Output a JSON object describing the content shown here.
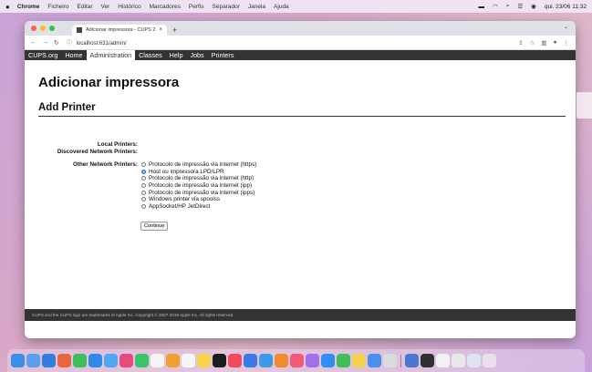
{
  "menubar": {
    "apple": "",
    "app": "Chrome",
    "items": [
      "Ficheiro",
      "Editar",
      "Ver",
      "Histórico",
      "Marcadores",
      "Perfis",
      "Separador",
      "Janela",
      "Ajuda"
    ],
    "clock": "qui. 23/06  11:32"
  },
  "browser": {
    "tab_title": "Adicionar impressora - CUPS 2.",
    "tab_close": "×",
    "new_tab": "+",
    "url_icon": "ⓘ",
    "url": "localhost:631/admin/"
  },
  "cupsnav": {
    "items": [
      "CUPS.org",
      "Home",
      "Administration",
      "Classes",
      "Help",
      "Jobs",
      "Printers"
    ],
    "active_index": 2
  },
  "page": {
    "heading": "Adicionar impressora",
    "subheading": "Add Printer",
    "labels": {
      "local": "Local Printers:",
      "discovered": "Discovered Network Printers:",
      "other": "Other Network Printers:"
    },
    "options": [
      "Protocolo de impressão via internet (https)",
      "Host ou impressora LPD/LPR",
      "Protocolo de impressão via internet (http)",
      "Protocolo de impressão via internet (ipp)",
      "Protocolo de impressão via internet (ipps)",
      "Windows printer via spoolss",
      "AppSocket/HP JetDirect"
    ],
    "selected_index": 1,
    "button": "Continue"
  },
  "footer": {
    "text": "CUPS and the CUPS logo are trademarks of Apple Inc. Copyright © 2007-2019 Apple Inc. All rights reserved."
  },
  "colors": {
    "cups_nav_bg": "#333333",
    "radio_selected": "#1a6ed8"
  }
}
